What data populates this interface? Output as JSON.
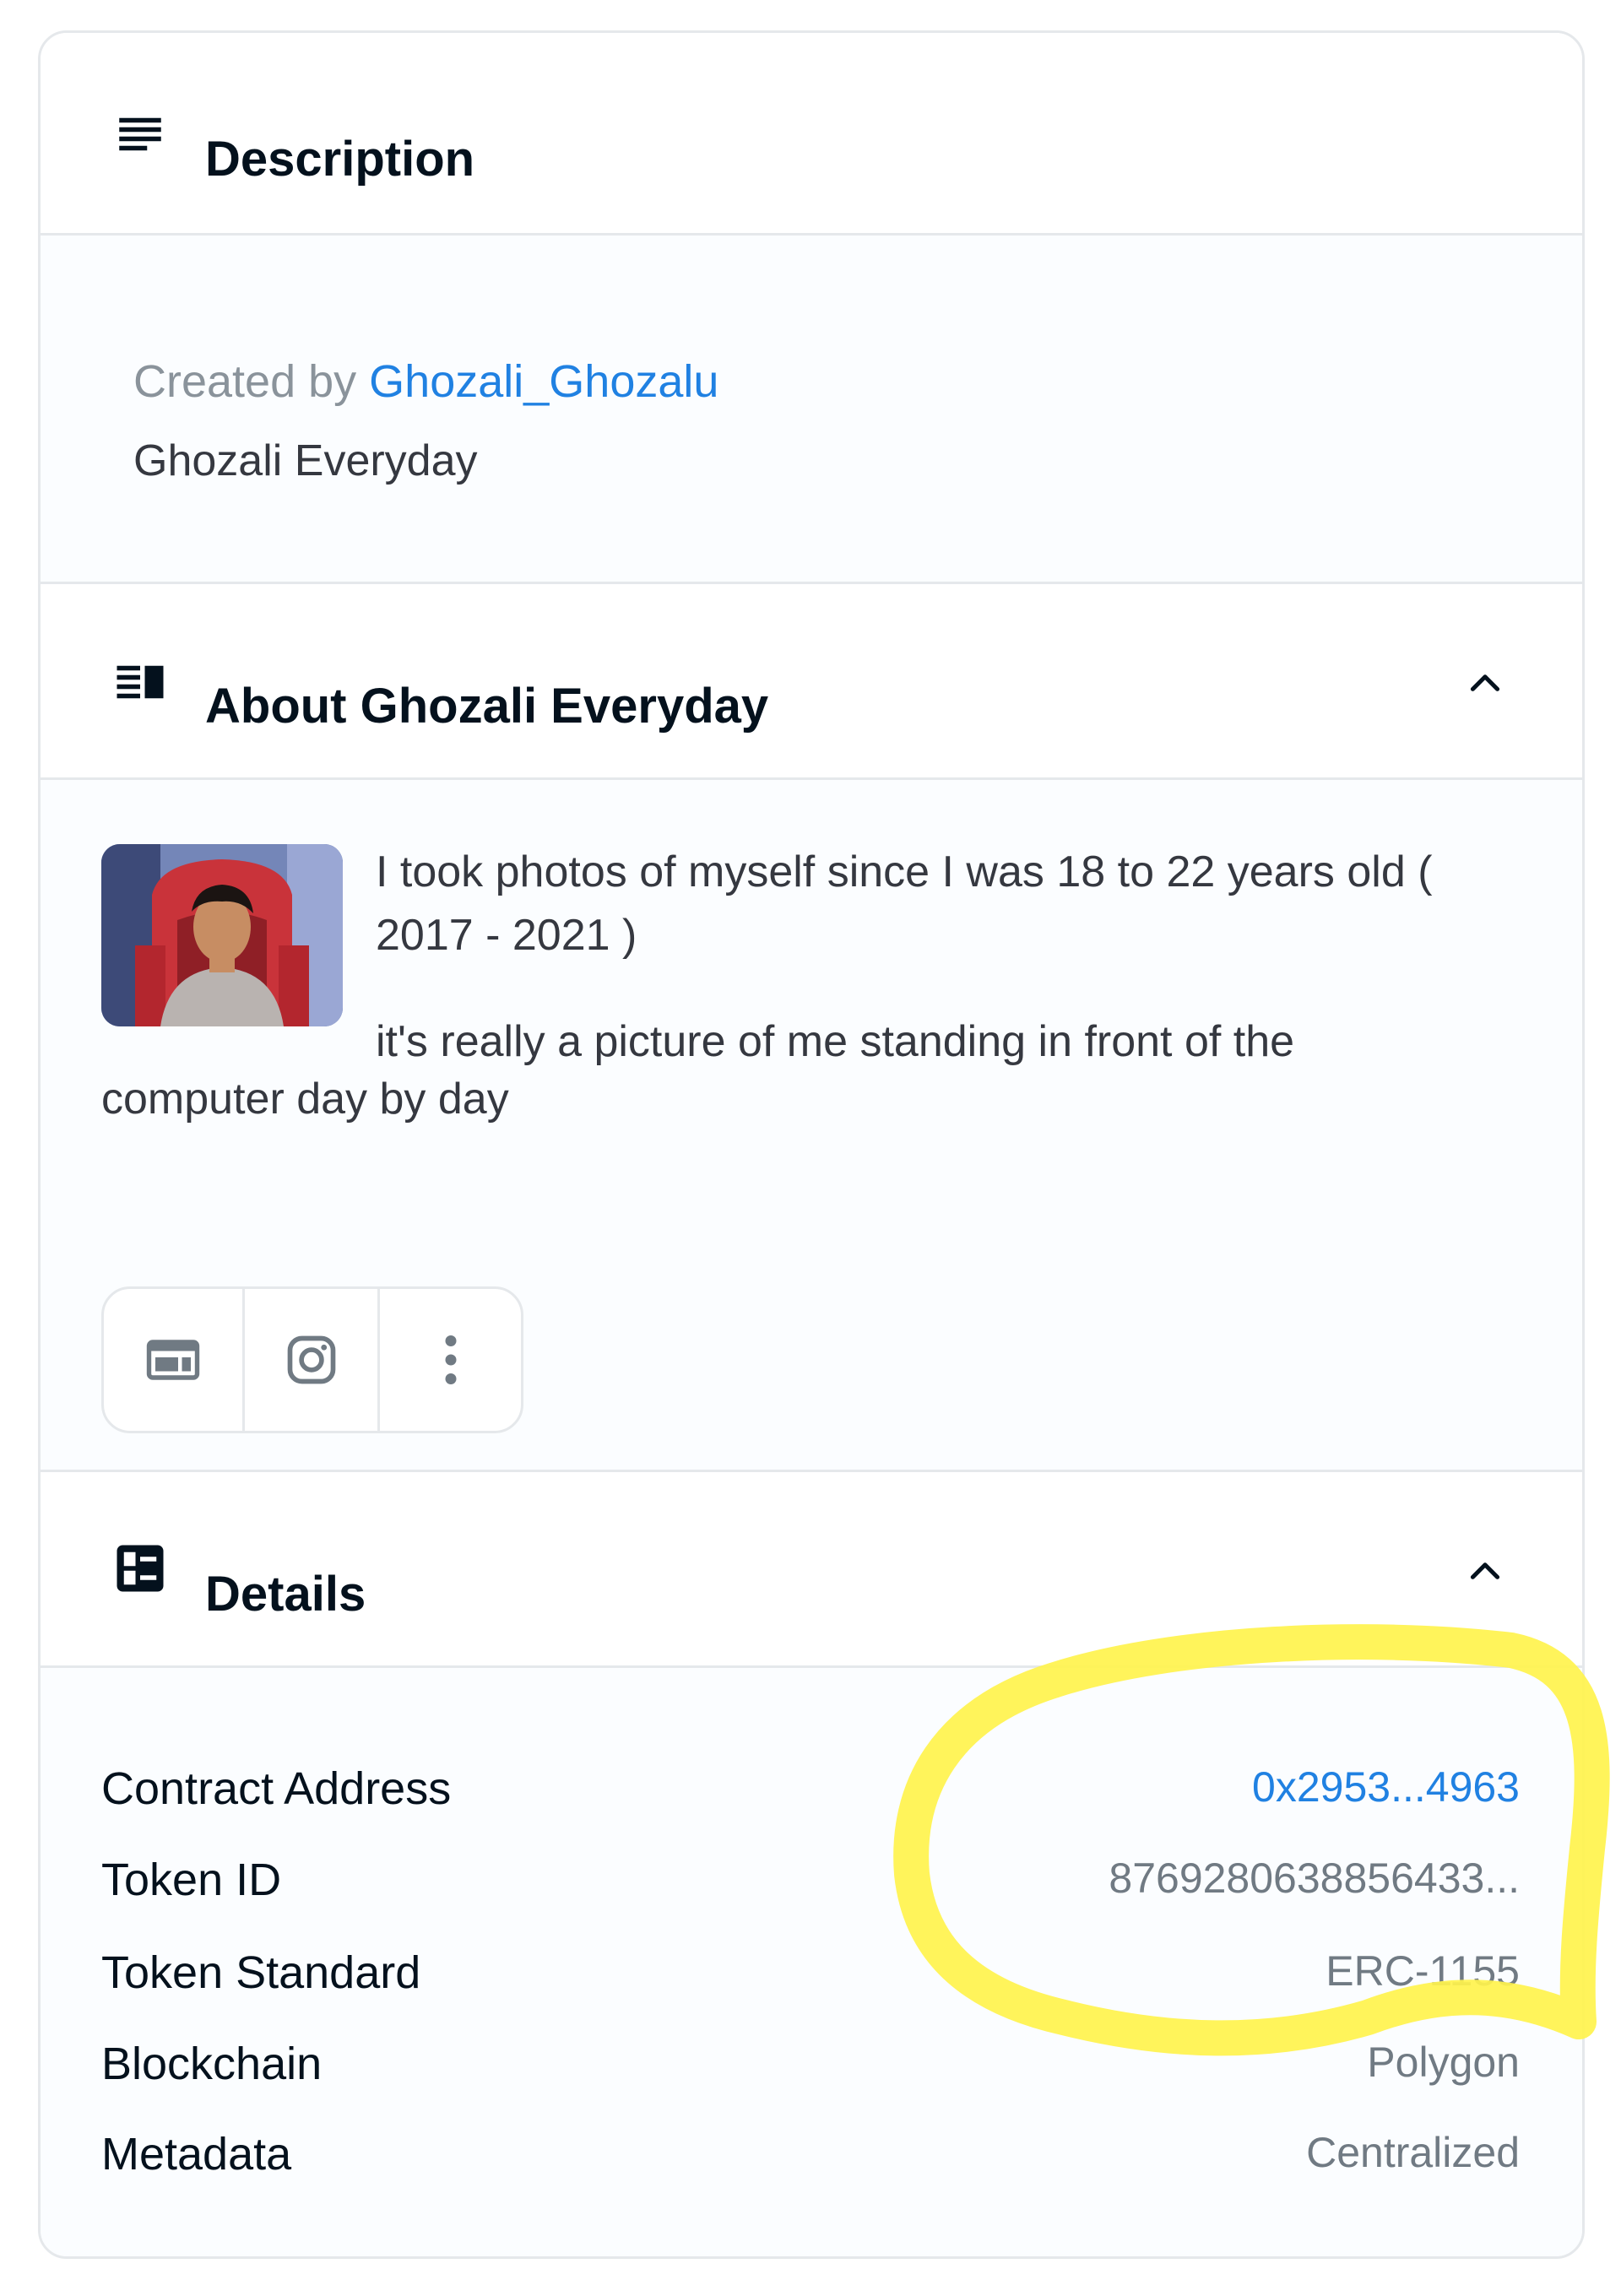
{
  "description": {
    "title": "Description",
    "created_label": "Created by",
    "creator": "Ghozali_Ghozalu",
    "text": "Ghozali Everyday"
  },
  "about": {
    "title": "About Ghozali Everyday",
    "paragraph1": "I took photos of myself since I was 18 to 22 years old ( 2017 - 2021 )",
    "paragraph2_start": "it's really a picture of me standing in front of the",
    "paragraph2_end": "computer day by day"
  },
  "details": {
    "title": "Details",
    "rows": [
      {
        "label": "Contract Address",
        "value": "0x2953...4963"
      },
      {
        "label": "Token ID",
        "value": "8769280638856433..."
      },
      {
        "label": "Token Standard",
        "value": "ERC-1155"
      },
      {
        "label": "Blockchain",
        "value": "Polygon"
      },
      {
        "label": "Metadata",
        "value": "Centralized"
      }
    ]
  },
  "colors": {
    "link": "#2081e2",
    "highlight": "#fff34d",
    "border": "#e5e8eb"
  },
  "icons": [
    "subject-icon",
    "article-icon",
    "expand-less-icon",
    "dashboard-icon",
    "website-icon",
    "instagram-icon",
    "more-vertical-icon"
  ]
}
